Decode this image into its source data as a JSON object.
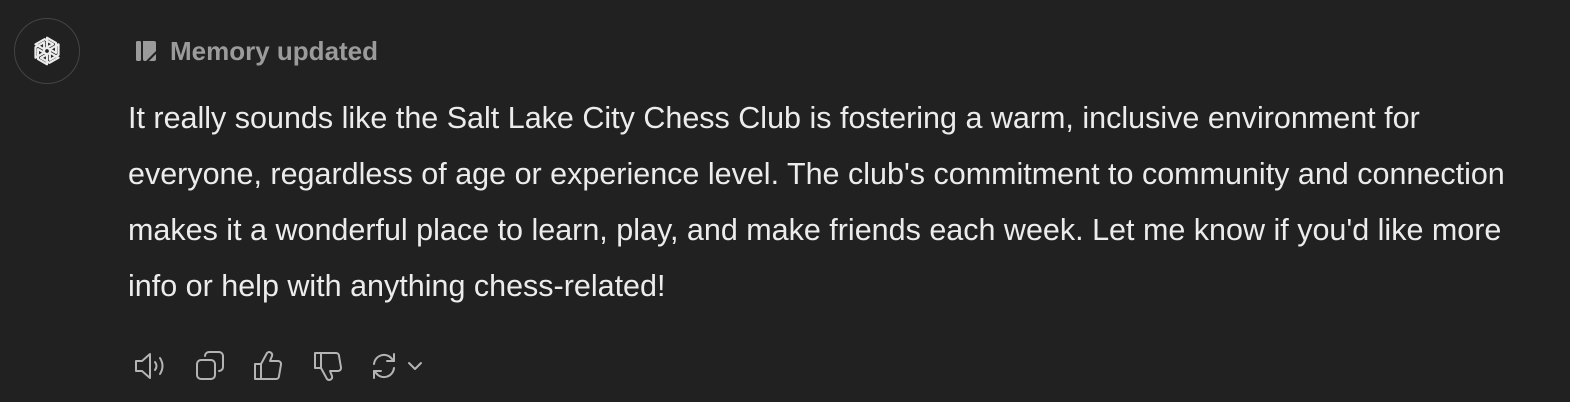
{
  "message": {
    "memory_status": "Memory updated",
    "text": "It really sounds like the Salt Lake City Chess Club is fostering a warm, inclusive environment for everyone, regardless of age or experience level. The club's commitment to community and connection makes it a wonderful place to learn, play, and make friends each week. Let me know if you'd like more info or help with anything chess-related!"
  },
  "icons": {
    "avatar": "openai-logo-icon",
    "memory": "memory-updated-icon",
    "actions": [
      "speaker-icon",
      "copy-icon",
      "thumbs-up-icon",
      "thumbs-down-icon",
      "regenerate-icon",
      "chevron-down-icon"
    ]
  },
  "colors": {
    "background": "#212121",
    "text": "#ececec",
    "muted": "#9b9b9b",
    "icon": "#b4b4b4"
  }
}
